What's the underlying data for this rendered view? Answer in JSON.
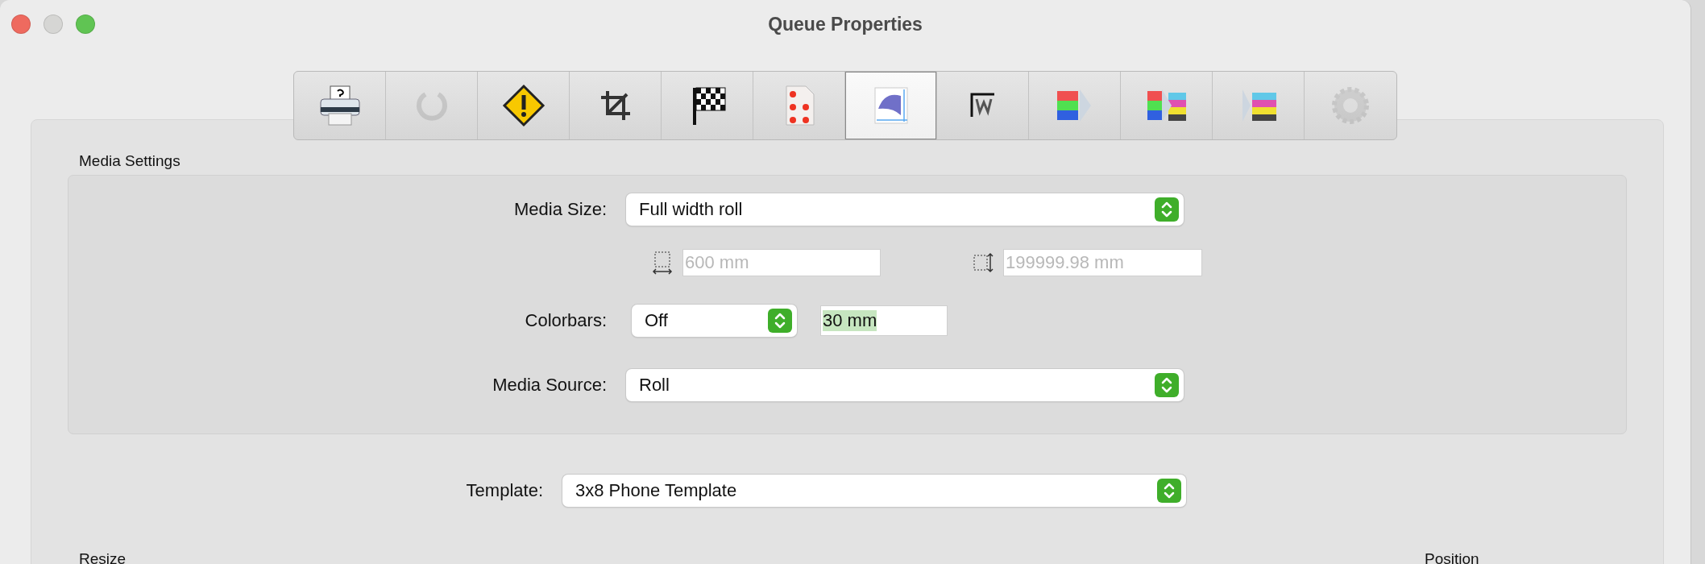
{
  "window": {
    "title": "Queue Properties"
  },
  "toolbar": [
    {
      "kind": "printer",
      "selected": false,
      "disabled": false
    },
    {
      "kind": "refresh",
      "selected": false,
      "disabled": true
    },
    {
      "kind": "warning",
      "selected": false,
      "disabled": false
    },
    {
      "kind": "crop",
      "selected": false,
      "disabled": false
    },
    {
      "kind": "flag",
      "selected": false,
      "disabled": false
    },
    {
      "kind": "layout",
      "selected": false,
      "disabled": false
    },
    {
      "kind": "media",
      "selected": true,
      "disabled": false
    },
    {
      "kind": "watermark",
      "selected": false,
      "disabled": false
    },
    {
      "kind": "rgb",
      "selected": false,
      "disabled": false
    },
    {
      "kind": "rgb-cmyk",
      "selected": false,
      "disabled": false
    },
    {
      "kind": "cmyk",
      "selected": false,
      "disabled": false
    },
    {
      "kind": "gear",
      "selected": false,
      "disabled": true
    }
  ],
  "media_settings": {
    "title": "Media Settings",
    "media_size": {
      "label": "Media Size:",
      "value": "Full width roll"
    },
    "width": {
      "value": "600 mm",
      "disabled": true
    },
    "height": {
      "value": "199999.98 mm",
      "disabled": true
    },
    "colorbars": {
      "label": "Colorbars:",
      "value": "Off",
      "amount": "30 mm",
      "amount_highlighted": true
    },
    "media_source": {
      "label": "Media Source:",
      "value": "Roll"
    }
  },
  "template": {
    "label": "Template:",
    "value": "3x8 Phone Template"
  },
  "resize": {
    "title": "Resize"
  },
  "position": {
    "title": "Position"
  }
}
